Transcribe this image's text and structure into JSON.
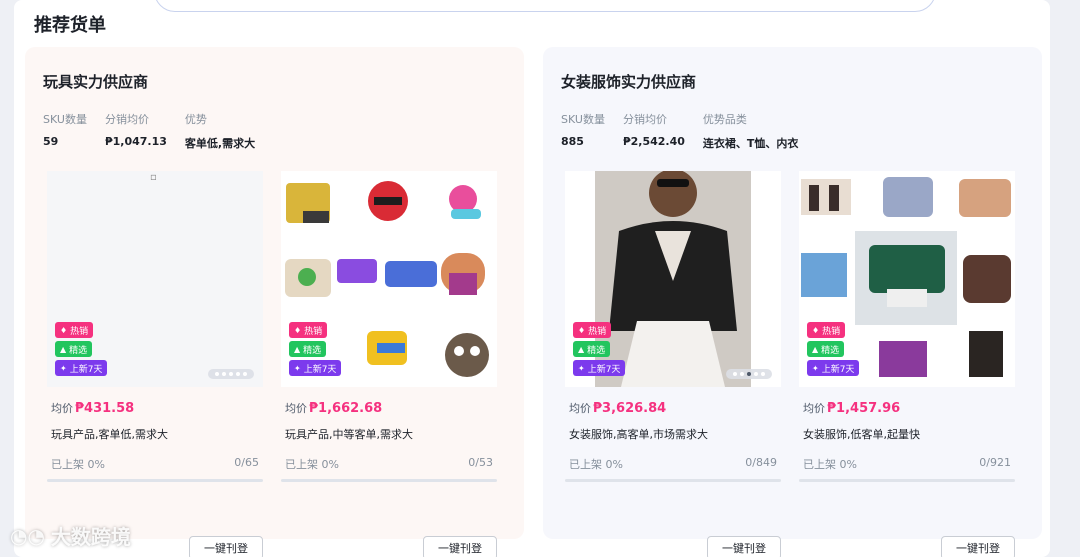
{
  "section_title": "推荐货单",
  "panels": [
    {
      "title": "玩具实力供应商",
      "stats": [
        {
          "label": "SKU数量",
          "value": "59"
        },
        {
          "label": "分销均价",
          "value": "₱1,047.13"
        },
        {
          "label": "优势",
          "value": "客单低,需求大"
        }
      ],
      "cards": [
        {
          "badges": [
            "热销",
            "精选",
            "上新7天"
          ],
          "price_label": "均价",
          "price": "₱431.58",
          "desc": "玩具产品,客单低,需求大",
          "listed_label": "已上架 0%",
          "count": "0/65",
          "button": "一键刊登",
          "listed_percent": 0
        },
        {
          "badges": [
            "热销",
            "精选",
            "上新7天"
          ],
          "price_label": "均价",
          "price": "₱1,662.68",
          "desc": "玩具产品,中等客单,需求大",
          "listed_label": "已上架 0%",
          "count": "0/53",
          "button": "一键刊登",
          "listed_percent": 0
        }
      ]
    },
    {
      "title": "女装服饰实力供应商",
      "stats": [
        {
          "label": "SKU数量",
          "value": "885"
        },
        {
          "label": "分销均价",
          "value": "₱2,542.40"
        },
        {
          "label": "优势品类",
          "value": "连衣裙、T恤、内衣"
        }
      ],
      "cards": [
        {
          "badges": [
            "热销",
            "精选",
            "上新7天"
          ],
          "price_label": "均价",
          "price": "₱3,626.84",
          "desc": "女装服饰,高客单,市场需求大",
          "listed_label": "已上架 0%",
          "count": "0/849",
          "button": "一键刊登",
          "listed_percent": 0
        },
        {
          "badges": [
            "热销",
            "精选",
            "上新7天"
          ],
          "price_label": "均价",
          "price": "₱1,457.96",
          "desc": "女装服饰,低客单,起量快",
          "listed_label": "已上架 0%",
          "count": "0/921",
          "button": "一键刊登",
          "listed_percent": 0
        }
      ]
    }
  ],
  "watermark": "大数跨境",
  "colors": {
    "hot": "#f5317f",
    "pick": "#22c55e",
    "new": "#7c3aed",
    "price": "#f5317f"
  }
}
